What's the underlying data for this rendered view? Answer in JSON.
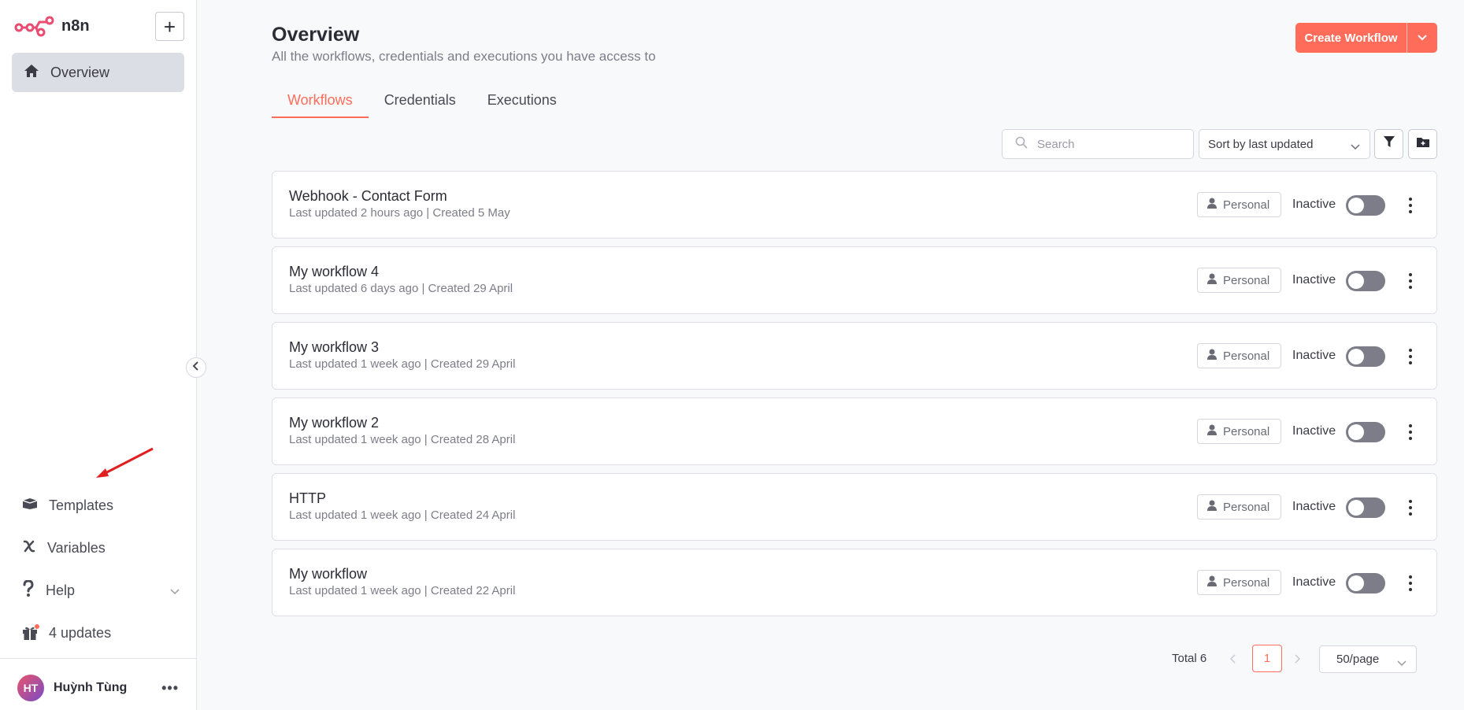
{
  "app": {
    "name": "n8n",
    "add_label": "+"
  },
  "sidebar": {
    "overview_label": "Overview",
    "bottom_items": [
      {
        "label": "Templates",
        "icon": "box-icon"
      },
      {
        "label": "Variables",
        "icon": "variable-icon"
      },
      {
        "label": "Help",
        "icon": "question-icon"
      },
      {
        "label": "4 updates",
        "icon": "gift-icon"
      }
    ],
    "user": {
      "initials": "HT",
      "name": "Huỳnh Tùng",
      "more": "•••"
    }
  },
  "header": {
    "title": "Overview",
    "subtitle": "All the workflows, credentials and executions you have access to",
    "create_label": "Create Workflow"
  },
  "tabs": [
    {
      "label": "Workflows",
      "active": true
    },
    {
      "label": "Credentials",
      "active": false
    },
    {
      "label": "Executions",
      "active": false
    }
  ],
  "toolbar": {
    "search_placeholder": "Search",
    "sort_label": "Sort by last updated"
  },
  "workflows": [
    {
      "name": "Webhook - Contact Form",
      "meta": "Last updated 2 hours ago | Created 5 May",
      "owner": "Personal",
      "status": "Inactive"
    },
    {
      "name": "My workflow 4",
      "meta": "Last updated 6 days ago | Created 29 April",
      "owner": "Personal",
      "status": "Inactive"
    },
    {
      "name": "My workflow 3",
      "meta": "Last updated 1 week ago | Created 29 April",
      "owner": "Personal",
      "status": "Inactive"
    },
    {
      "name": "My workflow 2",
      "meta": "Last updated 1 week ago | Created 28 April",
      "owner": "Personal",
      "status": "Inactive"
    },
    {
      "name": "HTTP",
      "meta": "Last updated 1 week ago | Created 24 April",
      "owner": "Personal",
      "status": "Inactive"
    },
    {
      "name": "My workflow",
      "meta": "Last updated 1 week ago | Created 22 April",
      "owner": "Personal",
      "status": "Inactive"
    }
  ],
  "pagination": {
    "total": "Total 6",
    "current_page": "1",
    "per_page": "50/page"
  },
  "colors": {
    "accent": "#ff6d5a",
    "toggle_off": "#7d7d89",
    "arrow": "#e02020"
  }
}
